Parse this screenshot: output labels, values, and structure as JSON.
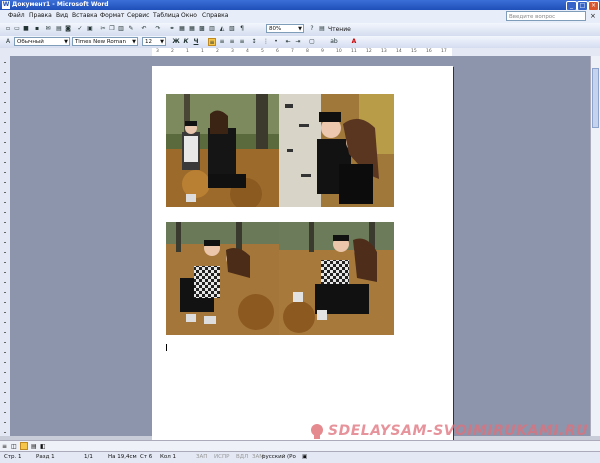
{
  "window": {
    "title": "Документ1 - Microsoft Word",
    "app_icon_letter": "W"
  },
  "menu": {
    "items": [
      "Файл",
      "Правка",
      "Вид",
      "Вставка",
      "Формат",
      "Сервис",
      "Таблица",
      "Окно",
      "Справка"
    ],
    "help_placeholder": "Введите вопрос",
    "close_glyph": "×"
  },
  "toolbar_standard": {
    "zoom": "80%",
    "reading_mode": "Чтение"
  },
  "toolbar_format": {
    "style": "Обычный",
    "font": "Times New Roman",
    "size": "12",
    "bold": "Ж",
    "italic": "К",
    "underline": "Ч",
    "font_color": "A"
  },
  "ruler": {
    "numbers": [
      "3",
      "2",
      "1",
      "1",
      "2",
      "3",
      "4",
      "5",
      "6",
      "7",
      "8",
      "9",
      "10",
      "11",
      "12",
      "13",
      "14",
      "15",
      "16",
      "17"
    ]
  },
  "document": {
    "photos": [
      {
        "name": "photo-1",
        "desc": "autumn-park"
      },
      {
        "name": "photo-2",
        "desc": "birch-tree"
      },
      {
        "name": "photo-3",
        "desc": "hug-leaves"
      },
      {
        "name": "photo-4",
        "desc": "sitting-leaves"
      }
    ]
  },
  "statusbar": {
    "page": "Стр. 1",
    "section": "Разд 1",
    "pages": "1/1",
    "position": "На 19,4см",
    "line": "Ст 6",
    "column": "Кол 1",
    "rec": "ЗАП",
    "trk": "ИСПР",
    "ext": "ВДЛ",
    "ovr": "ЗАМ",
    "language": "русский (Ро"
  },
  "watermark": {
    "text": "SDELAYSAM-SVOIMIRUKAMI.RU"
  },
  "colors": {
    "titlebar": "#2a5cc6",
    "workspace": "#8c95ac",
    "page": "#ffffff"
  }
}
